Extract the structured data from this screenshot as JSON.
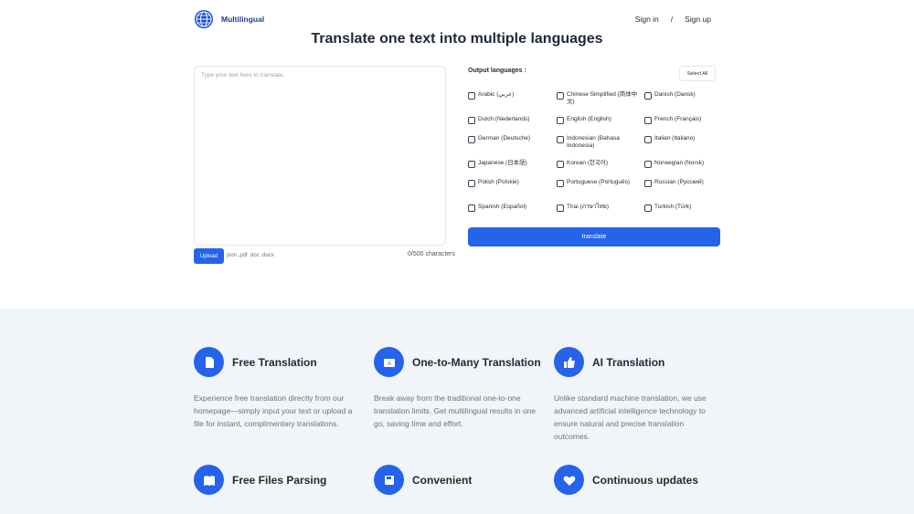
{
  "header": {
    "logo_text": "Multilingual",
    "sign_in": "Sign in",
    "separator": "/",
    "sign_up": "Sign up"
  },
  "title": "Translate one text into multiple languages",
  "input": {
    "placeholder": "Type your text here to translate.",
    "value": "",
    "upload_label": "Upload",
    "upload_hint": "json .pdf .doc .docx",
    "char_count": "0/500 characters"
  },
  "output": {
    "label": "Output languages :",
    "select_all": "Select All",
    "languages": [
      "Arabic (عربي)",
      "Chinese Simplified (简体中文)",
      "Danish (Dansk)",
      "Dutch (Nederlands)",
      "English (English)",
      "French (Français)",
      "German (Deutsche)",
      "Indonesian (Bahasa Indonesia)",
      "Italian (Italiano)",
      "Japanese (日本語)",
      "Korean (한국어)",
      "Norwegian (Norsk)",
      "Polish (Polskie)",
      "Portuguese (Português)",
      "Russian (Русский)",
      "Spanish (Español)",
      "Thai (ภาษาไทย)",
      "Turkish (Türk)"
    ],
    "translate_label": "translate"
  },
  "features": [
    {
      "icon": "document-icon",
      "title": "Free Translation",
      "desc": "Experience free translation directly from our homepage—simply input your text or upload a file for instant, complimentary translations."
    },
    {
      "icon": "translate-icon",
      "title": "One-to-Many Translation",
      "desc": "Break away from the traditional one-to-one translation limits. Get multilingual results in one go, saving time and effort."
    },
    {
      "icon": "thumbs-up-icon",
      "title": "AI Translation",
      "desc": "Unlike standard machine translation, we use advanced artificial intelligence technology to ensure natural and precise translation outcomes."
    },
    {
      "icon": "book-icon",
      "title": "Free Files Parsing",
      "desc": ""
    },
    {
      "icon": "save-icon",
      "title": "Convenient",
      "desc": ""
    },
    {
      "icon": "heart-icon",
      "title": "Continuous updates",
      "desc": ""
    }
  ],
  "colors": {
    "accent": "#2563eb",
    "logo_text": "#1d3f99",
    "features_bg": "#f1f4f8"
  }
}
